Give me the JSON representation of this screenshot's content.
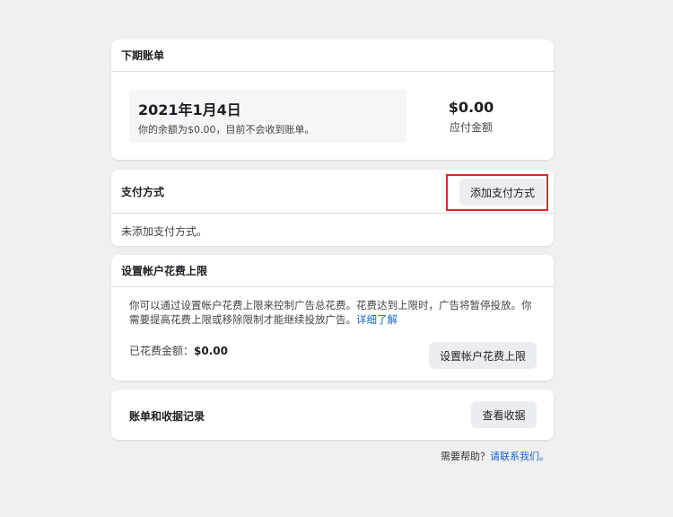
{
  "next_bill": {
    "title": "下期账单",
    "date": "2021年1月4日",
    "note": "你的余额为$0.00，目前不会收到账单。",
    "amount": "$0.00",
    "amount_label": "应付金额"
  },
  "payment": {
    "title": "支付方式",
    "add_button": "添加支付方式",
    "empty_text": "未添加支付方式。",
    "highlight_color": "#e0262c"
  },
  "spend_limit": {
    "title": "设置帐户花费上限",
    "description": "你可以通过设置帐户花费上限来控制广告总花费。花费达到上限时，广告将暂停投放。你需要提高花费上限或移除限制才能继续投放广告。",
    "learn_more": "详细了解",
    "spent_label": "已花费金额：",
    "spent_value": "$0.00",
    "set_button": "设置帐户花费上限"
  },
  "history": {
    "title": "账单和收据记录",
    "view_button": "查看收据"
  },
  "footer": {
    "help": "需要帮助？",
    "contact": "请联系我们。"
  }
}
